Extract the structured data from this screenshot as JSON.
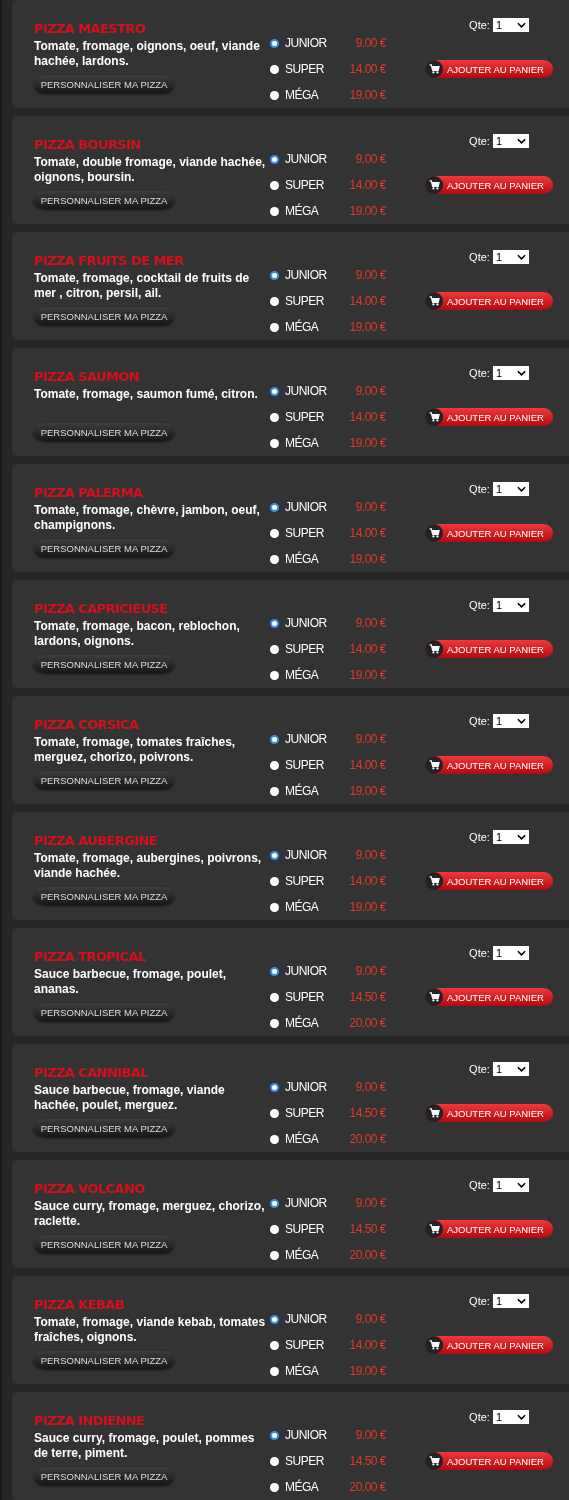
{
  "pizzas": [
    {
      "name": "PIZZA MAESTRO",
      "description": "Tomate, fromage, oignons, oeuf, viande hachée, lardons.",
      "customize_button": "PERSONNALISER MA PIZZA",
      "sizes": [
        {
          "label": "JUNIOR",
          "price": "9.00 €",
          "selected": true
        },
        {
          "label": "SUPER",
          "price": "14.00 €",
          "selected": false
        },
        {
          "label": "MÉGA",
          "price": "19.00 €",
          "selected": false
        }
      ],
      "quantity_label": "Qte:",
      "quantity": "1",
      "add_button": "AJOUTER AU PANIER"
    },
    {
      "name": "PIZZA BOURSIN",
      "description": "Tomate, double fromage, viande hachée, oignons, boursin.",
      "customize_button": "PERSONNALISER MA PIZZA",
      "sizes": [
        {
          "label": "JUNIOR",
          "price": "9.00 €",
          "selected": true
        },
        {
          "label": "SUPER",
          "price": "14.00 €",
          "selected": false
        },
        {
          "label": "MÉGA",
          "price": "19.00 €",
          "selected": false
        }
      ],
      "quantity_label": "Qte:",
      "quantity": "1",
      "add_button": "AJOUTER AU PANIER"
    },
    {
      "name": "PIZZA FRUITS DE MER",
      "description": "Tomate, fromage, cocktail de fruits de mer , citron, persil, ail.",
      "customize_button": "PERSONNALISER MA PIZZA",
      "sizes": [
        {
          "label": "JUNIOR",
          "price": "9.00 €",
          "selected": true
        },
        {
          "label": "SUPER",
          "price": "14.00 €",
          "selected": false
        },
        {
          "label": "MÉGA",
          "price": "19.00 €",
          "selected": false
        }
      ],
      "quantity_label": "Qte:",
      "quantity": "1",
      "add_button": "AJOUTER AU PANIER"
    },
    {
      "name": "PIZZA SAUMON",
      "description": "Tomate, fromage, saumon fumé, citron.",
      "customize_button": "PERSONNALISER MA PIZZA",
      "sizes": [
        {
          "label": "JUNIOR",
          "price": "9.00 €",
          "selected": true
        },
        {
          "label": "SUPER",
          "price": "14.00 €",
          "selected": false
        },
        {
          "label": "MÉGA",
          "price": "19.00 €",
          "selected": false
        }
      ],
      "quantity_label": "Qte:",
      "quantity": "1",
      "add_button": "AJOUTER AU PANIER"
    },
    {
      "name": "PIZZA PALERMA",
      "description": "Tomate, fromage, chèvre, jambon, oeuf, champignons.",
      "customize_button": "PERSONNALISER MA PIZZA",
      "sizes": [
        {
          "label": "JUNIOR",
          "price": "9.00 €",
          "selected": true
        },
        {
          "label": "SUPER",
          "price": "14.00 €",
          "selected": false
        },
        {
          "label": "MÉGA",
          "price": "19.00 €",
          "selected": false
        }
      ],
      "quantity_label": "Qte:",
      "quantity": "1",
      "add_button": "AJOUTER AU PANIER"
    },
    {
      "name": "PIZZA CAPRICIEUSE",
      "description": "Tomate, fromage, bacon, reblochon, lardons, oignons.",
      "customize_button": "PERSONNALISER MA PIZZA",
      "sizes": [
        {
          "label": "JUNIOR",
          "price": "9.00 €",
          "selected": true
        },
        {
          "label": "SUPER",
          "price": "14.00 €",
          "selected": false
        },
        {
          "label": "MÉGA",
          "price": "19.00 €",
          "selected": false
        }
      ],
      "quantity_label": "Qte:",
      "quantity": "1",
      "add_button": "AJOUTER AU PANIER"
    },
    {
      "name": "PIZZA CORSICA",
      "description": "Tomate, fromage, tomates fraîches, merguez, chorizo, poivrons.",
      "customize_button": "PERSONNALISER MA PIZZA",
      "sizes": [
        {
          "label": "JUNIOR",
          "price": "9.00 €",
          "selected": true
        },
        {
          "label": "SUPER",
          "price": "14.00 €",
          "selected": false
        },
        {
          "label": "MÉGA",
          "price": "19.00 €",
          "selected": false
        }
      ],
      "quantity_label": "Qte:",
      "quantity": "1",
      "add_button": "AJOUTER AU PANIER"
    },
    {
      "name": "PIZZA AUBERGINE",
      "description": "Tomate, fromage, aubergines, poivrons, viande hachée.",
      "customize_button": "PERSONNALISER MA PIZZA",
      "sizes": [
        {
          "label": "JUNIOR",
          "price": "9.00 €",
          "selected": true
        },
        {
          "label": "SUPER",
          "price": "14.00 €",
          "selected": false
        },
        {
          "label": "MÉGA",
          "price": "19.00 €",
          "selected": false
        }
      ],
      "quantity_label": "Qte:",
      "quantity": "1",
      "add_button": "AJOUTER AU PANIER"
    },
    {
      "name": "PIZZA TROPICAL",
      "description": "Sauce barbecue, fromage, poulet, ananas.",
      "customize_button": "PERSONNALISER MA PIZZA",
      "sizes": [
        {
          "label": "JUNIOR",
          "price": "9.00 €",
          "selected": true
        },
        {
          "label": "SUPER",
          "price": "14.50 €",
          "selected": false
        },
        {
          "label": "MÉGA",
          "price": "20.00 €",
          "selected": false
        }
      ],
      "quantity_label": "Qte:",
      "quantity": "1",
      "add_button": "AJOUTER AU PANIER"
    },
    {
      "name": "PIZZA CANNIBAL",
      "description": "Sauce barbecue, fromage, viande hachée, poulet, merguez.",
      "customize_button": "PERSONNALISER MA PIZZA",
      "sizes": [
        {
          "label": "JUNIOR",
          "price": "9.00 €",
          "selected": true
        },
        {
          "label": "SUPER",
          "price": "14.50 €",
          "selected": false
        },
        {
          "label": "MÉGA",
          "price": "20.00 €",
          "selected": false
        }
      ],
      "quantity_label": "Qte:",
      "quantity": "1",
      "add_button": "AJOUTER AU PANIER"
    },
    {
      "name": "PIZZA VOLCANO",
      "description": "Sauce curry, fromage, merguez, chorizo, raclette.",
      "customize_button": "PERSONNALISER MA PIZZA",
      "sizes": [
        {
          "label": "JUNIOR",
          "price": "9.00 €",
          "selected": true
        },
        {
          "label": "SUPER",
          "price": "14.50 €",
          "selected": false
        },
        {
          "label": "MÉGA",
          "price": "20.00 €",
          "selected": false
        }
      ],
      "quantity_label": "Qte:",
      "quantity": "1",
      "add_button": "AJOUTER AU PANIER"
    },
    {
      "name": "PIZZA KEBAB",
      "description": "Tomate, fromage, viande kebab, tomates fraîches, oignons.",
      "customize_button": "PERSONNALISER MA PIZZA",
      "sizes": [
        {
          "label": "JUNIOR",
          "price": "9.00 €",
          "selected": true
        },
        {
          "label": "SUPER",
          "price": "14.00 €",
          "selected": false
        },
        {
          "label": "MÉGA",
          "price": "19.00 €",
          "selected": false
        }
      ],
      "quantity_label": "Qte:",
      "quantity": "1",
      "add_button": "AJOUTER AU PANIER"
    },
    {
      "name": "PIZZA INDIENNE",
      "description": "Sauce curry, fromage, poulet, pommes de terre, piment.",
      "customize_button": "PERSONNALISER MA PIZZA",
      "sizes": [
        {
          "label": "JUNIOR",
          "price": "9.00 €",
          "selected": true
        },
        {
          "label": "SUPER",
          "price": "14.50 €",
          "selected": false
        },
        {
          "label": "MÉGA",
          "price": "20.00 €",
          "selected": false
        }
      ],
      "quantity_label": "Qte:",
      "quantity": "1",
      "add_button": "AJOUTER AU PANIER"
    }
  ]
}
